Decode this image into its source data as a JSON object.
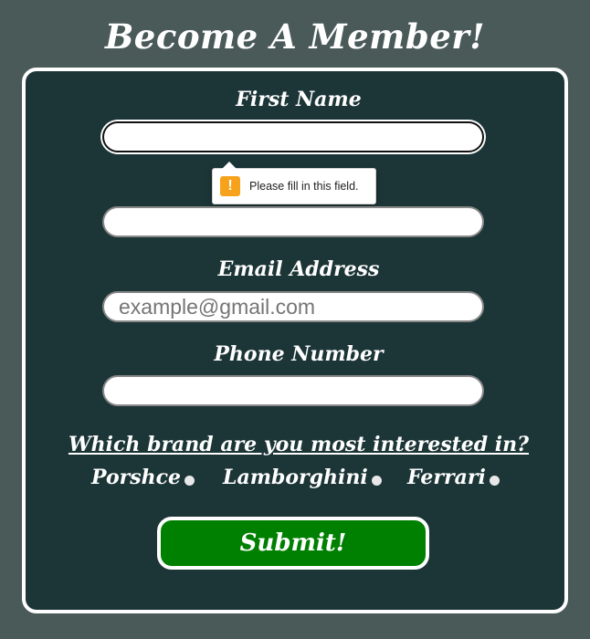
{
  "page": {
    "title": "Become A Member!"
  },
  "form": {
    "first_name": {
      "label": "First Name",
      "value": "",
      "placeholder": ""
    },
    "last_name": {
      "value": "",
      "placeholder": ""
    },
    "email": {
      "label": "Email Address",
      "value": "",
      "placeholder": "example@gmail.com"
    },
    "phone": {
      "label": "Phone Number",
      "value": "",
      "placeholder": ""
    },
    "validation_tooltip": {
      "icon": "warning-icon",
      "icon_glyph": "!",
      "message": "Please fill in this field."
    },
    "brand_question": "Which brand are you most interested in?",
    "brands": [
      {
        "label": "Porshce"
      },
      {
        "label": "Lamborghini"
      },
      {
        "label": "Ferrari"
      }
    ],
    "submit_label": "Submit!"
  },
  "colors": {
    "page_background": "#495a59",
    "card_background": "#1c3537",
    "submit_background": "#008000",
    "warning": "#f7a21b"
  }
}
